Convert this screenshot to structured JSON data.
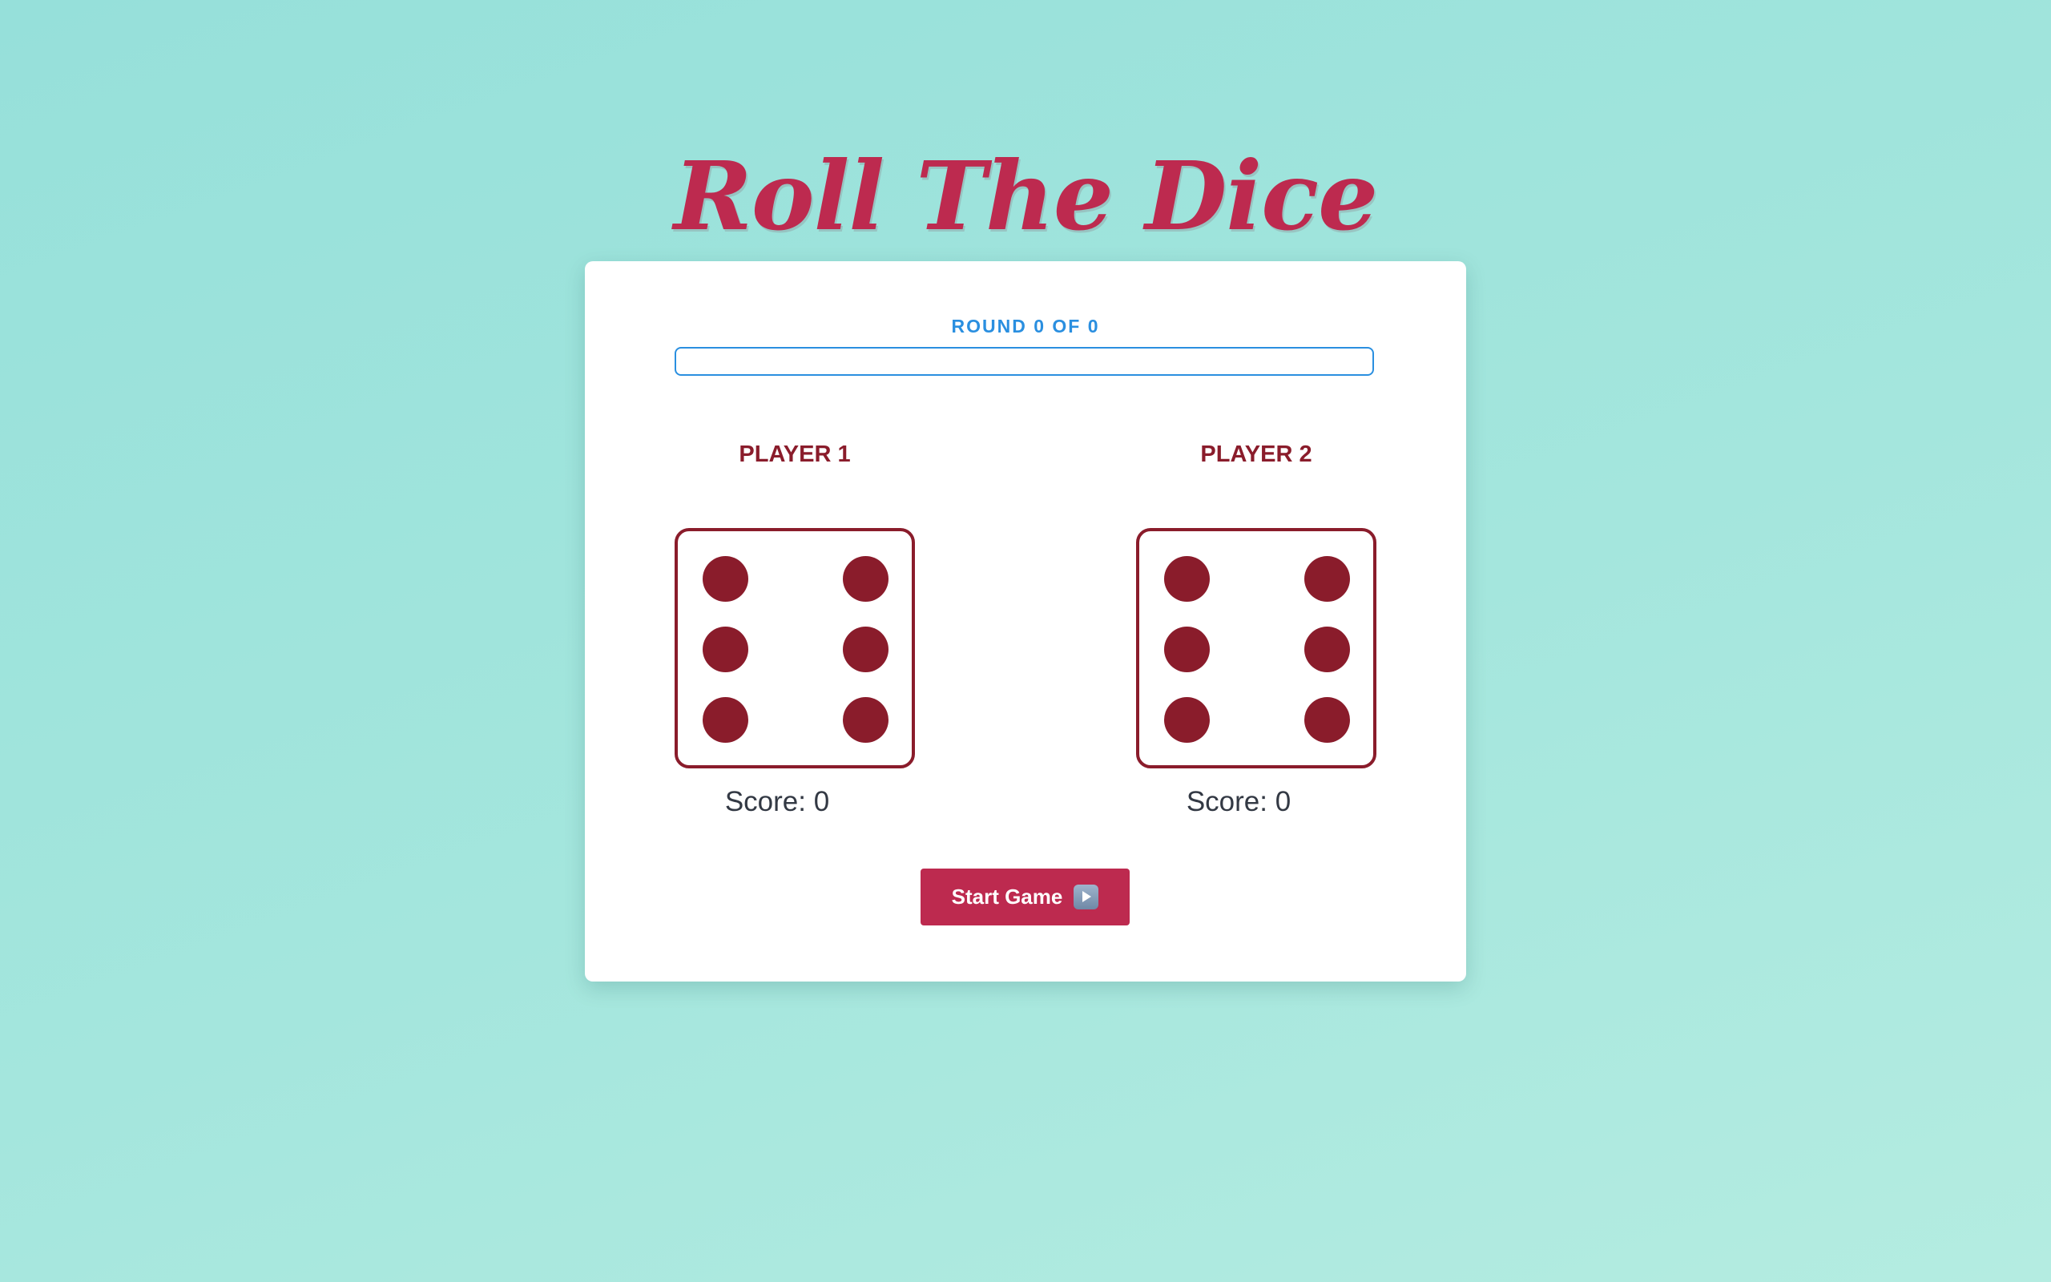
{
  "title": "Roll The Dice",
  "round": {
    "label": "ROUND 0 OF 0",
    "progress": 0
  },
  "players": [
    {
      "name": "PLAYER 1",
      "die_value": 6,
      "score_label": "Score: 0"
    },
    {
      "name": "PLAYER 2",
      "die_value": 6,
      "score_label": "Score: 0"
    }
  ],
  "start_button": {
    "label": "Start Game",
    "icon": "play-button-icon"
  },
  "colors": {
    "brand": "#bd2a4f",
    "dice": "#8a1c2b",
    "accent": "#2a8fe0",
    "background": "#9fe3dc"
  }
}
